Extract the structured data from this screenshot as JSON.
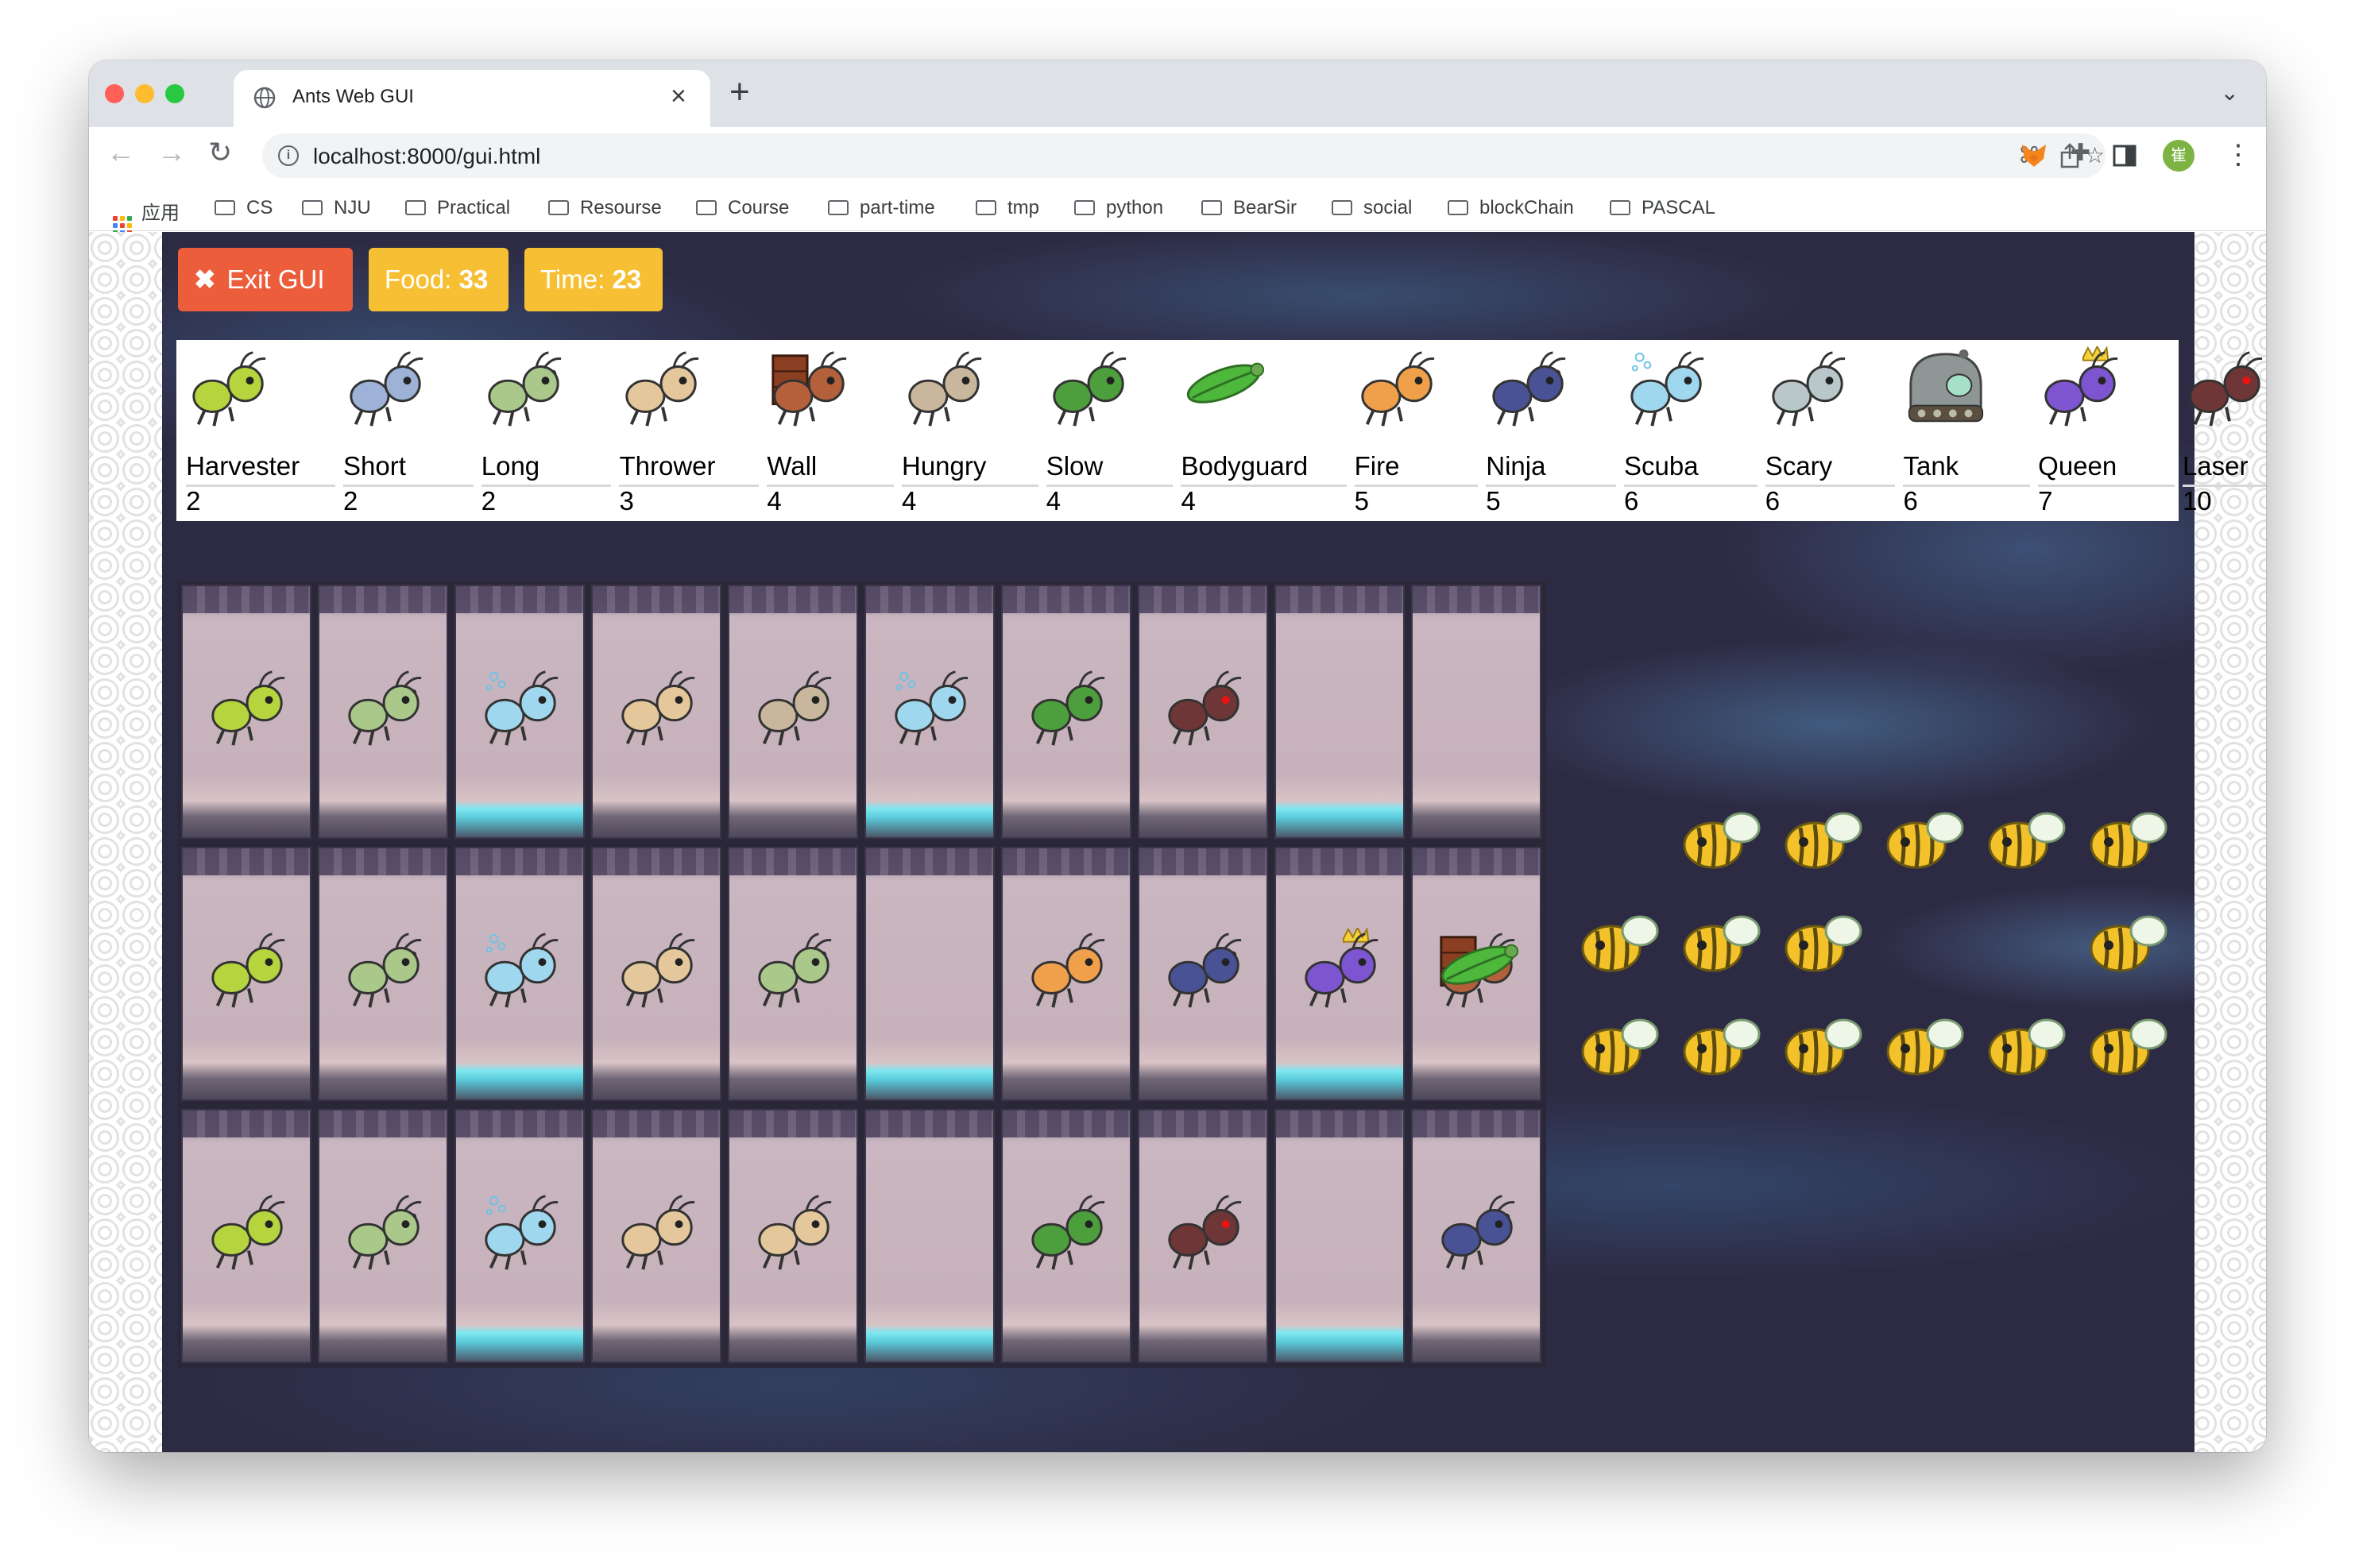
{
  "browser": {
    "tab_title": "Ants Web GUI",
    "url": "localhost:8000/gui.html",
    "bookmarks": [
      "应用",
      "CS",
      "NJU",
      "Practical",
      "Resourse",
      "Course",
      "part-time",
      "tmp",
      "python",
      "BearSir",
      "social",
      "blockChain",
      "PASCAL"
    ],
    "avatar_initial": "崔"
  },
  "controls": {
    "exit_label": "Exit GUI",
    "food_label": "Food:",
    "food_value": "33",
    "time_label": "Time:",
    "time_value": "23"
  },
  "store": [
    {
      "name": "Harvester",
      "cost": "2"
    },
    {
      "name": "Short",
      "cost": "2"
    },
    {
      "name": "Long",
      "cost": "2"
    },
    {
      "name": "Thrower",
      "cost": "3"
    },
    {
      "name": "Wall",
      "cost": "4"
    },
    {
      "name": "Hungry",
      "cost": "4"
    },
    {
      "name": "Slow",
      "cost": "4"
    },
    {
      "name": "Bodyguard",
      "cost": "4"
    },
    {
      "name": "Fire",
      "cost": "5"
    },
    {
      "name": "Ninja",
      "cost": "5"
    },
    {
      "name": "Scuba",
      "cost": "6"
    },
    {
      "name": "Scary",
      "cost": "6"
    },
    {
      "name": "Tank",
      "cost": "6"
    },
    {
      "name": "Queen",
      "cost": "7"
    },
    {
      "name": "Laser",
      "cost": "10"
    }
  ],
  "colors": {
    "exit_button": "#ec5d3c",
    "food_badge": "#f7c034",
    "time_badge": "#f7c034",
    "Harvester": "#b5d43e",
    "Short": "#9db2d6",
    "Long": "#a9c88a",
    "Thrower": "#e4c89c",
    "Wall": "#b4603a",
    "Hungry": "#c8b79c",
    "Slow": "#4d9e3c",
    "Bodyguard": "#4db83c",
    "Fire": "#f0a04a",
    "Ninja": "#4a5296",
    "Scuba": "#9fd7ee",
    "Scary": "#b9c7cb",
    "Tank": "#8e9696",
    "Queen": "#7e55d0",
    "Laser": "#6e3636"
  },
  "board": [
    [
      "Harvester",
      "Long",
      "Scuba",
      "Thrower",
      "Hungry",
      "Scuba",
      "Slow",
      "Laser",
      "",
      ""
    ],
    [
      "Harvester",
      "Long",
      "Scuba",
      "Thrower",
      "Long",
      "",
      "Fire",
      "Ninja",
      "Queen",
      "Wall+Bodyguard"
    ],
    [
      "Harvester",
      "Long",
      "Scuba",
      "Thrower",
      "Thrower",
      "",
      "Slow",
      "Laser",
      "",
      "Ninja"
    ]
  ],
  "water_tiles": [
    [
      false,
      false,
      true,
      false,
      false,
      true,
      false,
      false,
      true,
      false
    ],
    [
      false,
      false,
      true,
      false,
      false,
      true,
      false,
      false,
      true,
      false
    ],
    [
      false,
      false,
      true,
      false,
      false,
      true,
      false,
      false,
      true,
      false
    ]
  ],
  "bee_icon": "bee-icon"
}
